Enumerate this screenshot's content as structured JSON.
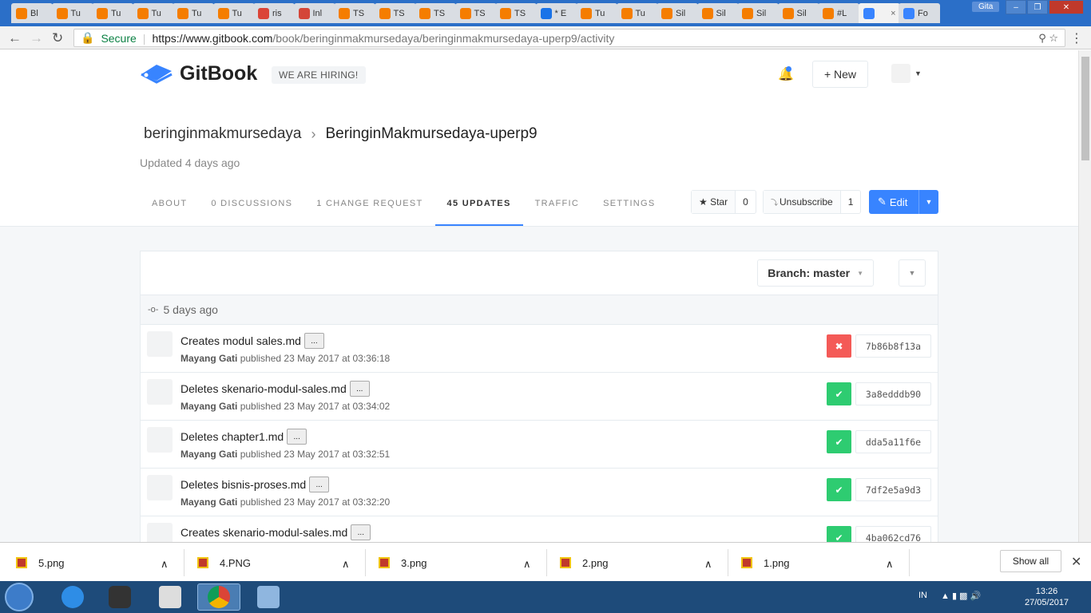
{
  "browser": {
    "tabs": [
      {
        "label": "Bl",
        "color": "#f57d00"
      },
      {
        "label": "Tu",
        "color": "#f57d00"
      },
      {
        "label": "Tu",
        "color": "#f57d00"
      },
      {
        "label": "Tu",
        "color": "#f57d00"
      },
      {
        "label": "Tu",
        "color": "#f57d00"
      },
      {
        "label": "Tu",
        "color": "#f57d00"
      },
      {
        "label": "ris",
        "color": "#db4437"
      },
      {
        "label": "Inl",
        "color": "#d44638"
      },
      {
        "label": "TS",
        "color": "#f57d00"
      },
      {
        "label": "TS",
        "color": "#f57d00"
      },
      {
        "label": "TS",
        "color": "#f57d00"
      },
      {
        "label": "TS",
        "color": "#f57d00"
      },
      {
        "label": "TS",
        "color": "#f57d00"
      },
      {
        "label": "* E",
        "color": "#1a73e8"
      },
      {
        "label": "Tu",
        "color": "#f57d00"
      },
      {
        "label": "Tu",
        "color": "#f57d00"
      },
      {
        "label": "Sil",
        "color": "#f57d00"
      },
      {
        "label": "Sil",
        "color": "#f57d00"
      },
      {
        "label": "Sil",
        "color": "#f57d00"
      },
      {
        "label": "Sil",
        "color": "#f57d00"
      },
      {
        "label": "#L",
        "color": "#f57d00"
      },
      {
        "label": "",
        "color": "#3884ff"
      },
      {
        "label": "Fo",
        "color": "#3884ff"
      }
    ],
    "user": "Gita",
    "secure_label": "Secure",
    "url_host": "https://www.gitbook.com",
    "url_path": "/book/beringinmakmursedaya/beringinmakmursedaya-uperp9/activity"
  },
  "header": {
    "logo_text": "GitBook",
    "hiring": "WE ARE HIRING!",
    "new_label": "+ New"
  },
  "book": {
    "owner": "beringinmakmursedaya",
    "title": "BeringinMakmursedaya-uperp9",
    "updated": "Updated 4 days ago"
  },
  "tabs": [
    {
      "label": "ABOUT",
      "active": false
    },
    {
      "label": "0 DISCUSSIONS",
      "active": false
    },
    {
      "label": "1 CHANGE REQUEST",
      "active": false
    },
    {
      "label": "45 UPDATES",
      "active": true
    },
    {
      "label": "TRAFFIC",
      "active": false
    },
    {
      "label": "SETTINGS",
      "active": false
    }
  ],
  "actions": {
    "star_label": "★ Star",
    "star_count": "0",
    "unsubscribe_label": "Unsubscribe",
    "unsubscribe_count": "1",
    "edit_label": "Edit"
  },
  "activity": {
    "branch_prefix": "Branch:",
    "branch": "master",
    "date_group": "5 days ago",
    "commits": [
      {
        "title": "Creates modul sales.md",
        "author": "Mayang Gati",
        "meta": "published 23 May 2017 at 03:36:18",
        "status": "fail",
        "sha": "7b86b8f13a"
      },
      {
        "title": "Deletes skenario-modul-sales.md",
        "author": "Mayang Gati",
        "meta": "published 23 May 2017 at 03:34:02",
        "status": "ok",
        "sha": "3a8edddb90"
      },
      {
        "title": "Deletes chapter1.md",
        "author": "Mayang Gati",
        "meta": "published 23 May 2017 at 03:32:51",
        "status": "ok",
        "sha": "dda5a11f6e"
      },
      {
        "title": "Deletes bisnis-proses.md",
        "author": "Mayang Gati",
        "meta": "published 23 May 2017 at 03:32:20",
        "status": "ok",
        "sha": "7df2e5a9d3"
      },
      {
        "title": "Creates skenario-modul-sales.md",
        "author": "",
        "meta": "",
        "status": "ok",
        "sha": "4ba062cd76"
      }
    ]
  },
  "downloads": {
    "files": [
      "5.png",
      "4.PNG",
      "3.png",
      "2.png",
      "1.png"
    ],
    "show_all": "Show all"
  },
  "taskbar": {
    "lang": "IN",
    "time": "13:26",
    "date": "27/05/2017"
  }
}
